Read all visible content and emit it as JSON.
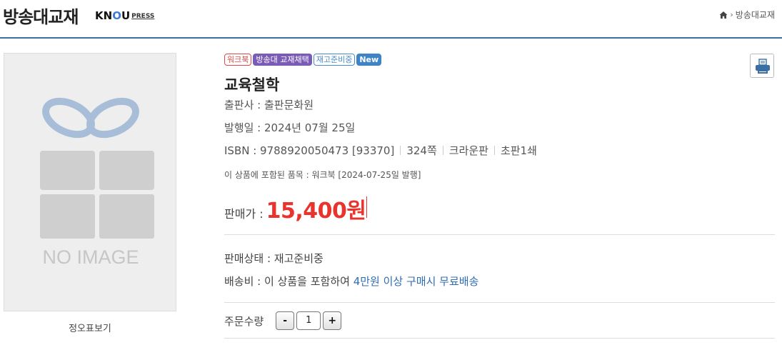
{
  "header": {
    "site_title": "방송대교재",
    "brand_k": "K",
    "brand_n": "N",
    "brand_o": "O",
    "brand_u": "U",
    "brand_press": "PRESS",
    "breadcrumb": "방송대교재"
  },
  "product_image": {
    "placeholder_text": "NO IMAGE",
    "view_toc_label": "정오표보기"
  },
  "badges": [
    "워크북",
    "방송대 교재채택",
    "재고준비중",
    "New"
  ],
  "book": {
    "title": "교육철학",
    "publisher_label": "출판사 : ",
    "publisher": "출판문화원",
    "date_label": "발행일 : ",
    "date": "2024년 07월 25일",
    "isbn_label": "ISBN : ",
    "isbn": "9788920050473 [93370]",
    "pages": "324쪽",
    "format": "크라운판",
    "edition": "초판1쇄",
    "included_note": "이 상품에 포함된 품목 :  워크북  [2024-07-25일 발행]"
  },
  "price": {
    "label": "판매가 : ",
    "value": "15,400원"
  },
  "status": {
    "sale_label": "판매상태 : ",
    "sale_value": "재고준비중",
    "shipping_label": "배송비 : ",
    "shipping_text": "이 상품을 포함하여 ",
    "shipping_link": "4만원 이상 구매시 무료배송"
  },
  "order": {
    "qty_label": "주문수량",
    "minus": "-",
    "qty_value": "1",
    "plus": "+"
  },
  "icons": {
    "home": "home-icon",
    "print": "print-icon",
    "gift": "gift-placeholder-icon"
  },
  "colors": {
    "accent": "#3a6ea5",
    "price": "#e8342c",
    "link": "#2f6db5"
  }
}
